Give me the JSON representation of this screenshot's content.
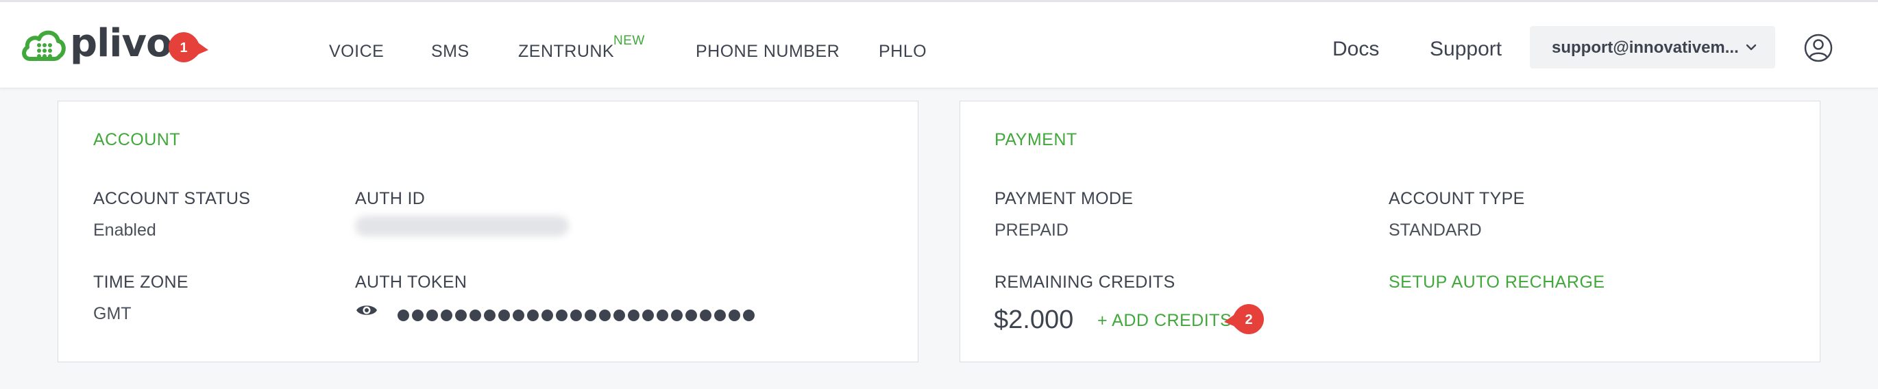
{
  "brand": {
    "logo_text": "plivo",
    "green": "#41a83b",
    "marker_red": "#e5413a"
  },
  "markers": [
    {
      "label": "1"
    },
    {
      "label": "2"
    }
  ],
  "nav": {
    "items": [
      {
        "label": "VOICE"
      },
      {
        "label": "SMS"
      },
      {
        "label": "ZENTRUNK",
        "badge": "NEW"
      },
      {
        "label": "PHONE NUMBER"
      },
      {
        "label": "PHLO"
      }
    ],
    "docs": "Docs",
    "support": "Support",
    "account_email": "support@innovativem...",
    "icons": [
      "cloud-phone-logo-icon",
      "chevron-down-icon",
      "user-circle-icon"
    ]
  },
  "account": {
    "title": "ACCOUNT",
    "status_label": "ACCOUNT STATUS",
    "status_value": "Enabled",
    "auth_id_label": "AUTH ID",
    "timezone_label": "TIME ZONE",
    "timezone_value": "GMT",
    "auth_token_label": "AUTH TOKEN",
    "icons": [
      "eye-icon"
    ]
  },
  "payment": {
    "title": "PAYMENT",
    "mode_label": "PAYMENT MODE",
    "mode_value": "PREPAID",
    "type_label": "ACCOUNT TYPE",
    "type_value": "STANDARD",
    "credits_label": "REMAINING CREDITS",
    "credits_value": "$2.000",
    "add_credits": "+ ADD CREDITS",
    "auto_recharge": "SETUP AUTO RECHARGE"
  }
}
